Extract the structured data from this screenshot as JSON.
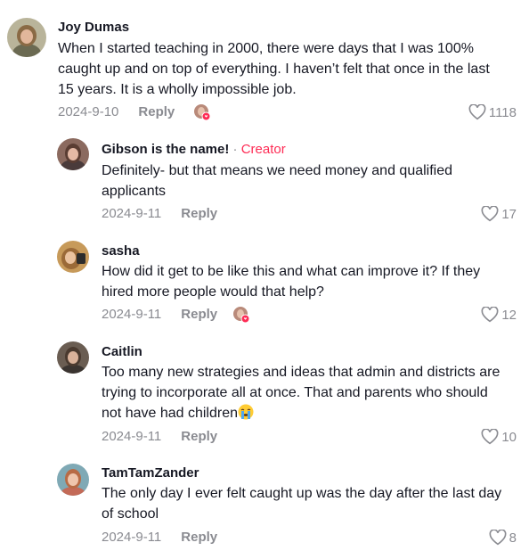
{
  "comments": [
    {
      "author": "Joy Dumas",
      "text": "When I started teaching in 2000, there were days that I was 100% caught up and on top of everything. I haven’t felt that once in the last 15 years. It is a wholly impossible job.",
      "date": "2024-9-10",
      "reply_label": "Reply",
      "likes": "1118",
      "liked_by_creator": true
    },
    {
      "author": "Gibson is the name!",
      "separator": "·",
      "badge": "Creator",
      "text": "Definitely- but that means we need money and qualified applicants",
      "date": "2024-9-11",
      "reply_label": "Reply",
      "likes": "17"
    },
    {
      "author": "sasha",
      "text": "How did it get to be like this and what can improve it? If they hired more people would that help?",
      "date": "2024-9-11",
      "reply_label": "Reply",
      "likes": "12",
      "liked_by_creator": true
    },
    {
      "author": "Caitlin",
      "text": "Too many new strategies and ideas that admin and districts are trying to incorporate all at once. That and parents who should not have had children",
      "emoji": "crying-face-emoji",
      "date": "2024-9-11",
      "reply_label": "Reply",
      "likes": "10"
    },
    {
      "author": "TamTamZander",
      "text": "The only day I ever felt caught up was the day after the last day of school",
      "date": "2024-9-11",
      "reply_label": "Reply",
      "likes": "8"
    }
  ],
  "colors": {
    "text": "#161823",
    "muted": "#8a8b91",
    "creator_badge": "#fe2c55"
  }
}
